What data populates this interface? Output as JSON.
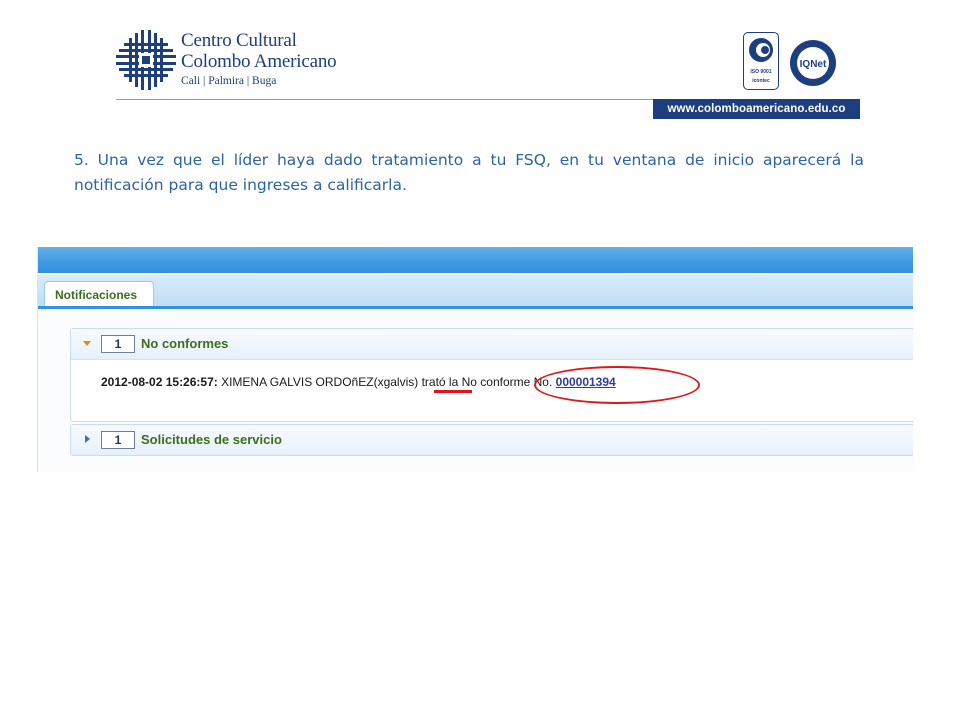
{
  "header": {
    "org_line1": "Centro Cultural",
    "org_line2": "Colombo Americano",
    "org_line3": "Cali | Palmira | Buga",
    "website": "www.colomboamericano.edu.co",
    "iso_label": "ISO 9001",
    "icontec_label": "icontec",
    "iqnet_label": "IQNet",
    "brand_color": "#1d3f7f"
  },
  "instruction": {
    "text": "5. Una vez que el líder haya dado tratamiento a tu FSQ, en tu ventana de inicio aparecerá la notificación para que ingreses a calificarla."
  },
  "app": {
    "tab_label": "Notificaciones",
    "sections": [
      {
        "count": "1",
        "title": "No conformes",
        "expanded": true,
        "notification": {
          "timestamp": "2012-08-02 15:26:57:",
          "text": " XIMENA GALVIS ORDOñEZ(xgalvis) trató la No conforme No. ",
          "link": "000001394"
        }
      },
      {
        "count": "1",
        "title": "Solicitudes de servicio",
        "expanded": false
      }
    ]
  },
  "annotation_color": "#e0161b"
}
